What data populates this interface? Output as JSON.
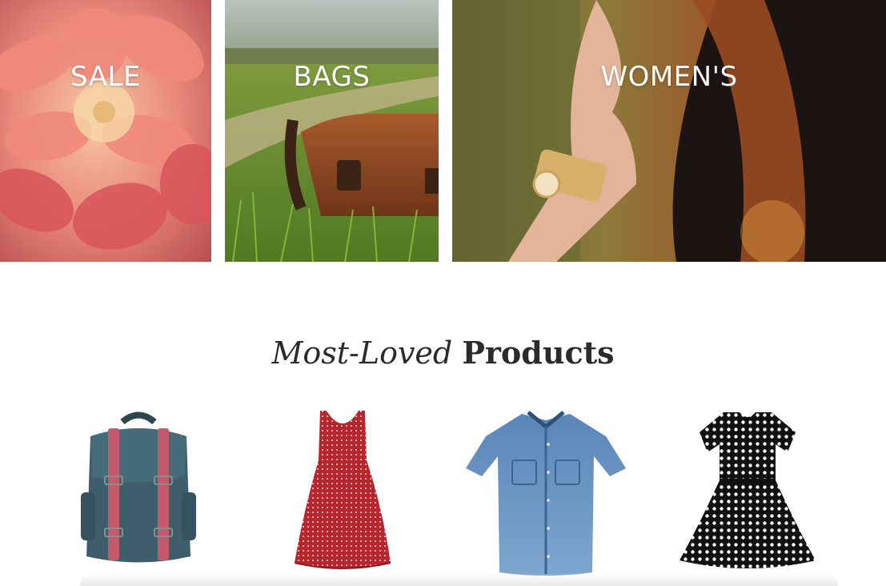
{
  "categories": [
    {
      "label": "SALE"
    },
    {
      "label": "BAGS"
    },
    {
      "label": "WOMEN'S"
    }
  ],
  "section": {
    "title_italic": "Most-Loved",
    "title_bold": "Products"
  },
  "products": [
    {
      "image": "teal-backpack-image"
    },
    {
      "image": "red-polka-dot-dress-image"
    },
    {
      "image": "denim-shirt-image"
    },
    {
      "image": "black-polka-dot-dress-image"
    }
  ],
  "colors": {
    "sale_overlay": "#e07a6a",
    "bags_leather": "#8a4a26",
    "womens_hair": "#9a4a22",
    "title_text": "#2b2b2b"
  }
}
